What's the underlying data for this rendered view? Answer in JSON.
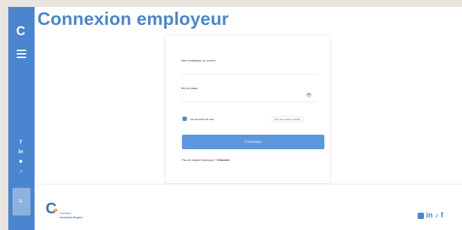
{
  "header": {
    "title": "Connexion employeur"
  },
  "sidebar": {
    "logo_glyph": "C",
    "social_glyphs": [
      "f",
      "in",
      "■",
      "♪"
    ],
    "active_glyph": "≡"
  },
  "form": {
    "email_label": "Nom d'utilisateur ou courriel",
    "email_value": "",
    "password_label": "Mot de passe",
    "password_value": "",
    "eye_glyph": "👁",
    "remember_label": "Se souvenir de moi",
    "forgot_label": "Mot de passe oublié?",
    "submit_label": "Connexion",
    "signup_prompt": "Pas de compte employeur ?",
    "signup_link": "S'inscrire"
  },
  "footer": {
    "logo_mark": "C",
    "logo_line1": "Carrefour",
    "logo_line2": "Jeunesse-Emploi",
    "socials": [
      "in",
      "♪",
      "f"
    ]
  },
  "colors": {
    "accent": "#4a86cf",
    "button": "#5d97dc",
    "background": "#e9e4df",
    "logo_dot": "#f0b323"
  }
}
